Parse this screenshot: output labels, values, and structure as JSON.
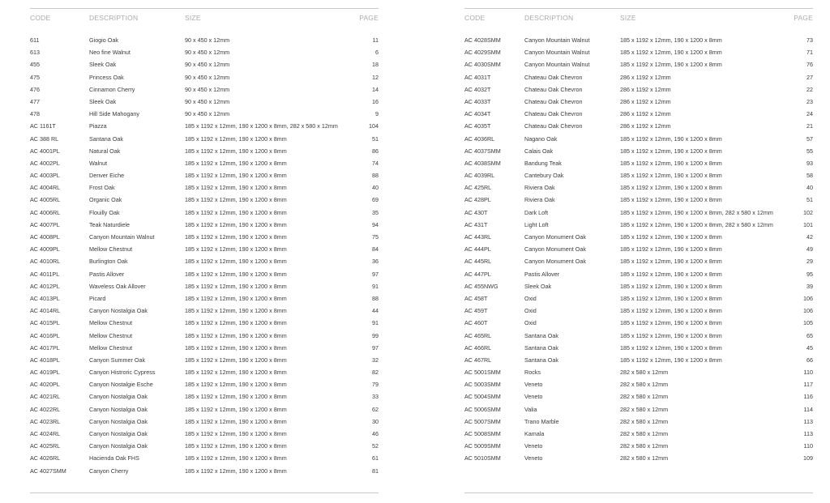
{
  "headers": {
    "code": "CODE",
    "description": "DESCRIPTION",
    "size": "SIZE",
    "page": "PAGE"
  },
  "left_rows": [
    [
      "611",
      "Giogio Oak",
      "90 x 450 x 12mm",
      "11"
    ],
    [
      "613",
      "Neo fine Walnut",
      "90 x 450 x 12mm",
      "6"
    ],
    [
      "455",
      "Sleek Oak",
      "90 x 450 x 12mm",
      "18"
    ],
    [
      "475",
      "Princess Oak",
      "90 x 450 x 12mm",
      "12"
    ],
    [
      "476",
      "Cinnamon Cherry",
      "90 x 450 x 12mm",
      "14"
    ],
    [
      "477",
      "Sleek Oak",
      "90 x 450 x 12mm",
      "16"
    ],
    [
      "478",
      "Hill Side Mahogany",
      "90 x 450 x 12mm",
      "9"
    ],
    [
      "AC 1161T",
      "Piazza",
      "185 x 1192 x 12mm, 190 x 1200 x 8mm, 282 x 580 x 12mm",
      "104"
    ],
    [
      "AC 388 RL",
      "Santana Oak",
      "185 x 1192 x 12mm, 190 x 1200 x 8mm",
      "51"
    ],
    [
      "AC 4001PL",
      "Natural Oak",
      "185 x 1192 x 12mm, 190 x 1200 x 8mm",
      "86"
    ],
    [
      "AC 4002PL",
      "Walnut",
      "185 x 1192 x 12mm, 190 x 1200 x 8mm",
      "74"
    ],
    [
      "AC 4003PL",
      "Denver Eiche",
      "185 x 1192 x 12mm, 190 x 1200 x 8mm",
      "88"
    ],
    [
      "AC 4004RL",
      "Frost Oak",
      "185 x 1192 x 12mm, 190 x 1200 x 8mm",
      "40"
    ],
    [
      "AC 4005RL",
      "Organic Oak",
      "185 x 1192 x 12mm, 190 x 1200 x 8mm",
      "69"
    ],
    [
      "AC 4006RL",
      "Flouilly Oak",
      "185 x 1192 x 12mm, 190 x 1200 x 8mm",
      "35"
    ],
    [
      "AC 4007PL",
      "Teak Naturdiele",
      "185 x 1192 x 12mm, 190 x 1200 x 8mm",
      "94"
    ],
    [
      "AC 4008PL",
      "Canyon Mountain Walnut",
      "185 x 1192 x 12mm, 190 x 1200 x 8mm",
      "75"
    ],
    [
      "AC 4009PL",
      "Mellow Chestnut",
      "185 x 1192 x 12mm, 190 x 1200 x 8mm",
      "84"
    ],
    [
      "AC 4010RL",
      "Burlington Oak",
      "185 x 1192 x 12mm, 190 x 1200 x 8mm",
      "36"
    ],
    [
      "AC 4011PL",
      "Pastis Allover",
      "185 x 1192 x 12mm, 190 x 1200 x 8mm",
      "97"
    ],
    [
      "AC 4012PL",
      "Waveless Oak Allover",
      "185 x 1192 x 12mm, 190 x 1200 x 8mm",
      "91"
    ],
    [
      "AC 4013PL",
      "Picard",
      "185 x 1192 x 12mm, 190 x 1200 x 8mm",
      "88"
    ],
    [
      "AC 4014RL",
      "Canyon Nostalgia Oak",
      "185 x 1192 x 12mm, 190 x 1200 x 8mm",
      "44"
    ],
    [
      "AC 4015PL",
      "Mellow Chestnut",
      "185 x 1192 x 12mm, 190 x 1200 x 8mm",
      "91"
    ],
    [
      "AC 4016PL",
      "Mellow Chestnut",
      "185 x 1192 x 12mm, 190 x 1200 x 8mm",
      "99"
    ],
    [
      "AC 4017PL",
      "Mellow Chestnut",
      "185 x 1192 x 12mm, 190 x 1200 x 8mm",
      "97"
    ],
    [
      "AC 4018PL",
      "Canyon Summer Oak",
      "185 x 1192 x 12mm, 190 x 1200 x 8mm",
      "32"
    ],
    [
      "AC 4019PL",
      "Canyon Histroric Cypress",
      "185 x 1192 x 12mm, 190 x 1200 x 8mm",
      "82"
    ],
    [
      "AC 4020PL",
      "Canyon Nostalgie Esche",
      "185 x 1192 x 12mm, 190 x 1200 x 8mm",
      "79"
    ],
    [
      "AC 4021RL",
      "Canyon Nostalgia Oak",
      "185 x 1192 x 12mm, 190 x 1200 x 8mm",
      "33"
    ],
    [
      "AC 4022RL",
      "Canyon Nostalgia Oak",
      "185 x 1192 x 12mm, 190 x 1200 x 8mm",
      "62"
    ],
    [
      "AC 4023RL",
      "Canyon Nostalgia Oak",
      "185 x 1192 x 12mm, 190 x 1200 x 8mm",
      "30"
    ],
    [
      "AC 4024RL",
      "Canyon Nostalgia Oak",
      "185 x 1192 x 12mm, 190 x 1200 x 8mm",
      "46"
    ],
    [
      "AC 4025RL",
      "Canyon Nostalgia Oak",
      "185 x 1192 x 12mm, 190 x 1200 x 8mm",
      "52"
    ],
    [
      "AC 4026RL",
      "Hacienda Oak FHS",
      "185 x 1192 x 12mm, 190 x 1200 x 8mm",
      "61"
    ],
    [
      "AC 4027SMM",
      "Canyon Cherry",
      "185 x 1192 x 12mm, 190 x 1200 x 8mm",
      "81"
    ]
  ],
  "right_rows": [
    [
      "AC 4028SMM",
      "Canyon Mountain Walnut",
      "185 x 1192 x 12mm, 190 x 1200 x 8mm",
      "73"
    ],
    [
      "AC 4029SMM",
      "Canyon Mountain Walnut",
      "185 x 1192 x 12mm, 190 x 1200 x 8mm",
      "71"
    ],
    [
      "AC 4030SMM",
      "Canyon Mountain Walnut",
      "185 x 1192 x 12mm, 190 x 1200 x 8mm",
      "76"
    ],
    [
      "AC 4031T",
      "Chateau Oak Chevron",
      "286 x 1192 x 12mm",
      "27"
    ],
    [
      "AC 4032T",
      "Chateau Oak Chevron",
      "286 x 1192 x 12mm",
      "22"
    ],
    [
      "AC 4033T",
      "Chateau Oak Chevron",
      "286 x 1192 x 12mm",
      "23"
    ],
    [
      "AC 4034T",
      "Chateau Oak Chevron",
      "286 x 1192 x 12mm",
      "24"
    ],
    [
      "AC 4035T",
      "Chateau Oak Chevron",
      "286 x 1192 x 12mm",
      "21"
    ],
    [
      "AC 4036RL",
      "Nagano Oak",
      "185 x 1192 x 12mm, 190 x 1200 x 8mm",
      "57"
    ],
    [
      "AC 4037SMM",
      "Calais Oak",
      "185 x 1192 x 12mm, 190 x 1200 x 8mm",
      "55"
    ],
    [
      "AC 4038SMM",
      "Bandung Teak",
      "185 x 1192 x 12mm, 190 x 1200 x 8mm",
      "93"
    ],
    [
      "AC 4039RL",
      "Cantebury Oak",
      "185 x 1192 x 12mm, 190 x 1200 x 8mm",
      "58"
    ],
    [
      "AC 425RL",
      "Riviera Oak",
      "185 x 1192 x 12mm, 190 x 1200 x 8mm",
      "40"
    ],
    [
      "AC 428PL",
      "Riviera Oak",
      "185 x 1192 x 12mm, 190 x 1200 x 8mm",
      "51"
    ],
    [
      "AC 430T",
      "Dark Loft",
      "185 x 1192 x 12mm, 190 x 1200 x 8mm, 282 x 580 x 12mm",
      "102"
    ],
    [
      "AC 431T",
      "Light Loft",
      "185 x 1192 x 12mm, 190 x 1200 x 8mm, 282 x 580 x 12mm",
      "101"
    ],
    [
      "AC 443RL",
      "Canyon Monument Oak",
      "185 x 1192 x 12mm, 190 x 1200 x 8mm",
      "42"
    ],
    [
      "AC 444PL",
      "Canyon Monument Oak",
      "185 x 1192 x 12mm, 190 x 1200 x 8mm",
      "49"
    ],
    [
      "AC 445RL",
      "Canyon Monument Oak",
      "185 x 1192 x 12mm, 190 x 1200 x 8mm",
      "29"
    ],
    [
      "AC 447PL",
      "Pastis Allover",
      "185 x 1192 x 12mm, 190 x 1200 x 8mm",
      "95"
    ],
    [
      "AC 455NWG",
      "Sleek Oak",
      "185 x 1192 x 12mm, 190 x 1200 x 8mm",
      "39"
    ],
    [
      "AC 458T",
      "Oxid",
      "185 x 1192 x 12mm, 190 x 1200 x 8mm",
      "106"
    ],
    [
      "AC 459T",
      "Oxid",
      "185 x 1192 x 12mm, 190 x 1200 x 8mm",
      "106"
    ],
    [
      "AC 460T",
      "Oxid",
      "185 x 1192 x 12mm, 190 x 1200 x 8mm",
      "105"
    ],
    [
      "AC 465RL",
      "Santana Oak",
      "185 x 1192 x 12mm, 190 x 1200 x 8mm",
      "65"
    ],
    [
      "AC 466RL",
      "Santana Oak",
      "185 x 1192 x 12mm, 190 x 1200 x 8mm",
      "45"
    ],
    [
      "AC 467RL",
      "Santana Oak",
      "185 x 1192 x 12mm, 190 x 1200 x 8mm",
      "66"
    ],
    [
      "AC 5001SMM",
      "Rocks",
      "282 x 580 x 12mm",
      "110"
    ],
    [
      "AC 5003SMM",
      "Veneto",
      "282 x 580 x 12mm",
      "117"
    ],
    [
      "AC 5004SMM",
      "Veneto",
      "282 x 580 x 12mm",
      "116"
    ],
    [
      "AC 5006SMM",
      "Valia",
      "282 x 580 x 12mm",
      "114"
    ],
    [
      "AC 5007SMM",
      "Trano Marble",
      "282 x 580 x 12mm",
      "113"
    ],
    [
      "AC 5008SMM",
      "Kamala",
      "282 x 580 x 12mm",
      "113"
    ],
    [
      "AC 5009SMM",
      "Veneto",
      "282 x 580 x 12mm",
      "110"
    ],
    [
      "AC 5010SMM",
      "Veneto",
      "282 x 580 x 12mm",
      "109"
    ]
  ]
}
